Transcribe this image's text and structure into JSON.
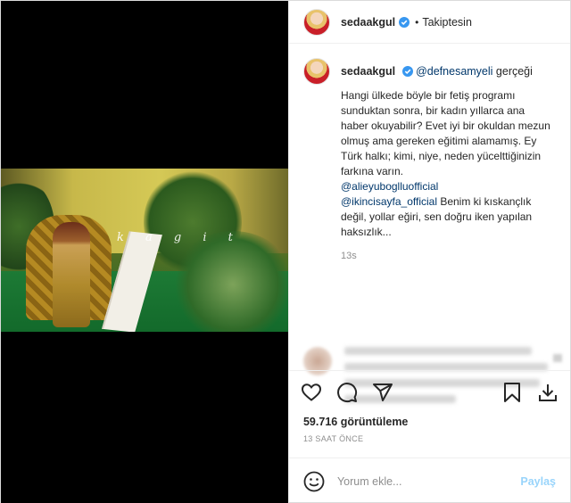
{
  "header": {
    "username": "sedaakgul",
    "separator": "•",
    "follow_status": "Takiptesin"
  },
  "caption": {
    "username": "sedaakgul",
    "mention": "@defnesamyeli",
    "head_suffix": " gerçeği",
    "text_part1": "Hangi ülkede böyle bir fetiş programı sunduktan sonra, bir kadın yıllarca ana haber okuyabilir? Evet iyi bir okuldan mezun olmuş ama gereken eğitimi alamamış. Ey Türk halkı; kimi, niye, neden yücelttiğinizin farkına varın.",
    "mention2": "@alieyuboglluofficial",
    "mention3": "@ikincisayfa_official",
    "text_part2": " Benim ki kıskançlık değil, yollar eğiri, sen doğru iken yapılan haksızlık...",
    "time": "13s"
  },
  "media": {
    "overlay_text": "k a  g  i  t"
  },
  "icons": {
    "like": "heart-icon",
    "comment": "comment-icon",
    "share": "share-icon",
    "save": "bookmark-icon",
    "download": "download-icon",
    "emoji": "emoji-icon",
    "verified": "verified-badge-icon"
  },
  "stats": {
    "views": "59.716 görüntüleme",
    "ago": "13 SAAT ÖNCE"
  },
  "comment_box": {
    "placeholder": "Yorum ekle...",
    "post_label": "Paylaş"
  },
  "colors": {
    "verified": "#3897f0",
    "link": "#00376b",
    "post_button": "#0095f6"
  }
}
